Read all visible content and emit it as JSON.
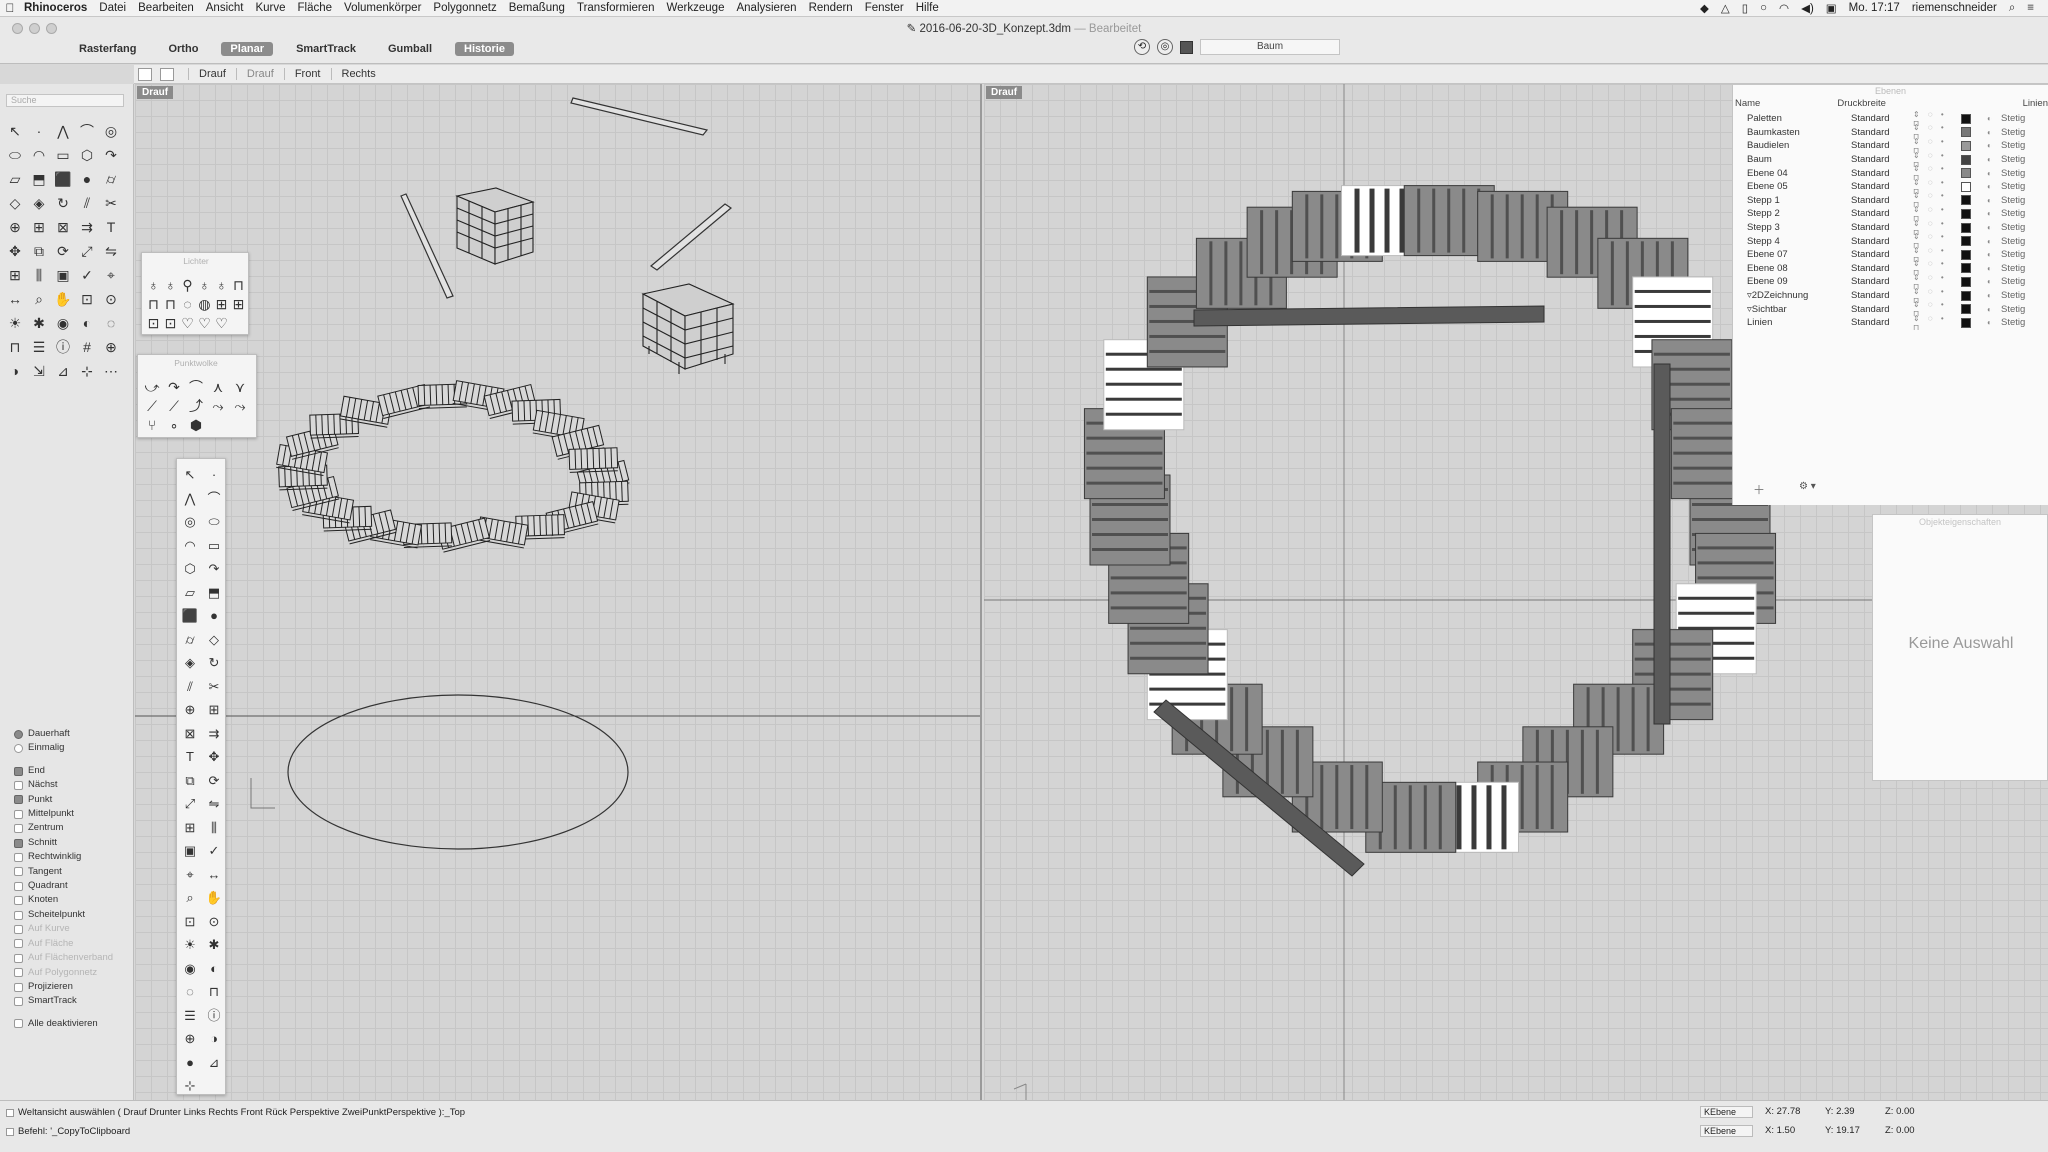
{
  "menubar": {
    "app": "Rhinoceros",
    "items": [
      "Datei",
      "Bearbeiten",
      "Ansicht",
      "Kurve",
      "Fläche",
      "Volumenkörper",
      "Polygonnetz",
      "Bemaßung",
      "Transformieren",
      "Werkzeuge",
      "Analysieren",
      "Rendern",
      "Fenster",
      "Hilfe"
    ],
    "clock": "Mo. 17:17",
    "user": "riemenschneider"
  },
  "window": {
    "title": "2016-06-20-3D_Konzept.3dm",
    "edited": "— Bearbeitet"
  },
  "toggles": [
    {
      "label": "Rasterfang",
      "on": false
    },
    {
      "label": "Ortho",
      "on": false
    },
    {
      "label": "Planar",
      "on": true
    },
    {
      "label": "SmartTrack",
      "on": false
    },
    {
      "label": "Gumball",
      "on": false
    },
    {
      "label": "Historie",
      "on": true
    }
  ],
  "current_layer": "Baum",
  "viewtabs": [
    "Drauf",
    "Drauf",
    "Front",
    "Rechts"
  ],
  "search_placeholder": "Suche",
  "viewports": {
    "left_label": "Drauf",
    "right_label": "Drauf"
  },
  "panels": {
    "points_title": "Punktwolke",
    "lights_title": "Lichter"
  },
  "osnaps": {
    "mode": [
      {
        "label": "Dauerhaft",
        "on": true
      },
      {
        "label": "Einmalig",
        "on": false
      }
    ],
    "snaps": [
      {
        "label": "End",
        "on": true,
        "dim": false
      },
      {
        "label": "Nächst",
        "on": false,
        "dim": false
      },
      {
        "label": "Punkt",
        "on": true,
        "dim": false
      },
      {
        "label": "Mittelpunkt",
        "on": false,
        "dim": false
      },
      {
        "label": "Zentrum",
        "on": false,
        "dim": false
      },
      {
        "label": "Schnitt",
        "on": true,
        "dim": false
      },
      {
        "label": "Rechtwinklig",
        "on": false,
        "dim": false
      },
      {
        "label": "Tangent",
        "on": false,
        "dim": false
      },
      {
        "label": "Quadrant",
        "on": false,
        "dim": false
      },
      {
        "label": "Knoten",
        "on": false,
        "dim": false
      },
      {
        "label": "Scheitelpunkt",
        "on": false,
        "dim": false
      },
      {
        "label": "Auf Kurve",
        "on": false,
        "dim": true
      },
      {
        "label": "Auf Fläche",
        "on": false,
        "dim": true
      },
      {
        "label": "Auf Flächenverband",
        "on": false,
        "dim": true
      },
      {
        "label": "Auf Polygonnetz",
        "on": false,
        "dim": true
      },
      {
        "label": "Projizieren",
        "on": false,
        "dim": false
      },
      {
        "label": "SmartTrack",
        "on": false,
        "dim": false
      }
    ],
    "disable_all": "Alle deaktivieren"
  },
  "layers": {
    "title": "Ebenen",
    "headers": {
      "name": "Name",
      "print": "Druckbreite",
      "linetype": "Linien"
    },
    "rows": [
      {
        "name": "Paletten",
        "print": "Standard",
        "color": "#111111",
        "lt": "Stetig"
      },
      {
        "name": "Baumkasten",
        "print": "Standard",
        "color": "#777777",
        "lt": "Stetig"
      },
      {
        "name": "Baudielen",
        "print": "Standard",
        "color": "#999999",
        "lt": "Stetig"
      },
      {
        "name": "Baum",
        "print": "Standard",
        "color": "#444444",
        "lt": "Stetig"
      },
      {
        "name": "Ebene 04",
        "print": "Standard",
        "color": "#888888",
        "lt": "Stetig"
      },
      {
        "name": "Ebene 05",
        "print": "Standard",
        "color": "#ffffff",
        "lt": "Stetig"
      },
      {
        "name": "Stepp 1",
        "print": "Standard",
        "color": "#111111",
        "lt": "Stetig"
      },
      {
        "name": "Stepp 2",
        "print": "Standard",
        "color": "#111111",
        "lt": "Stetig"
      },
      {
        "name": "Stepp 3",
        "print": "Standard",
        "color": "#111111",
        "lt": "Stetig"
      },
      {
        "name": "Stepp 4",
        "print": "Standard",
        "color": "#111111",
        "lt": "Stetig"
      },
      {
        "name": "Ebene 07",
        "print": "Standard",
        "color": "#111111",
        "lt": "Stetig"
      },
      {
        "name": "Ebene 08",
        "print": "Standard",
        "color": "#111111",
        "lt": "Stetig"
      },
      {
        "name": "Ebene 09",
        "print": "Standard",
        "color": "#111111",
        "lt": "Stetig"
      },
      {
        "name": "▿2DZeichnung",
        "print": "Standard",
        "color": "#111111",
        "lt": "Stetig"
      },
      {
        "name": "▿Sichtbar",
        "print": "Standard",
        "color": "#111111",
        "lt": "Stetig"
      },
      {
        "name": "Linien",
        "print": "Standard",
        "color": "#111111",
        "lt": "Stetig"
      }
    ]
  },
  "objprops": {
    "title": "Objekteigenschaften",
    "empty": "Keine Auswahl"
  },
  "status": {
    "prompt": "Weltansicht auswählen ( Drauf Drunter Links Rechts Front Rück Perspektive ZweiPunktPerspektive ):_Top",
    "command": "Befehl: '_CopyToClipboard",
    "row1": {
      "layer": "KEbene",
      "x": "X: 27.78",
      "y": "Y: 2.39",
      "z": "Z: 0.00"
    },
    "row2": {
      "layer": "KEbene",
      "x": "X: 1.50",
      "y": "Y: 19.17",
      "z": "Z: 0.00"
    }
  }
}
